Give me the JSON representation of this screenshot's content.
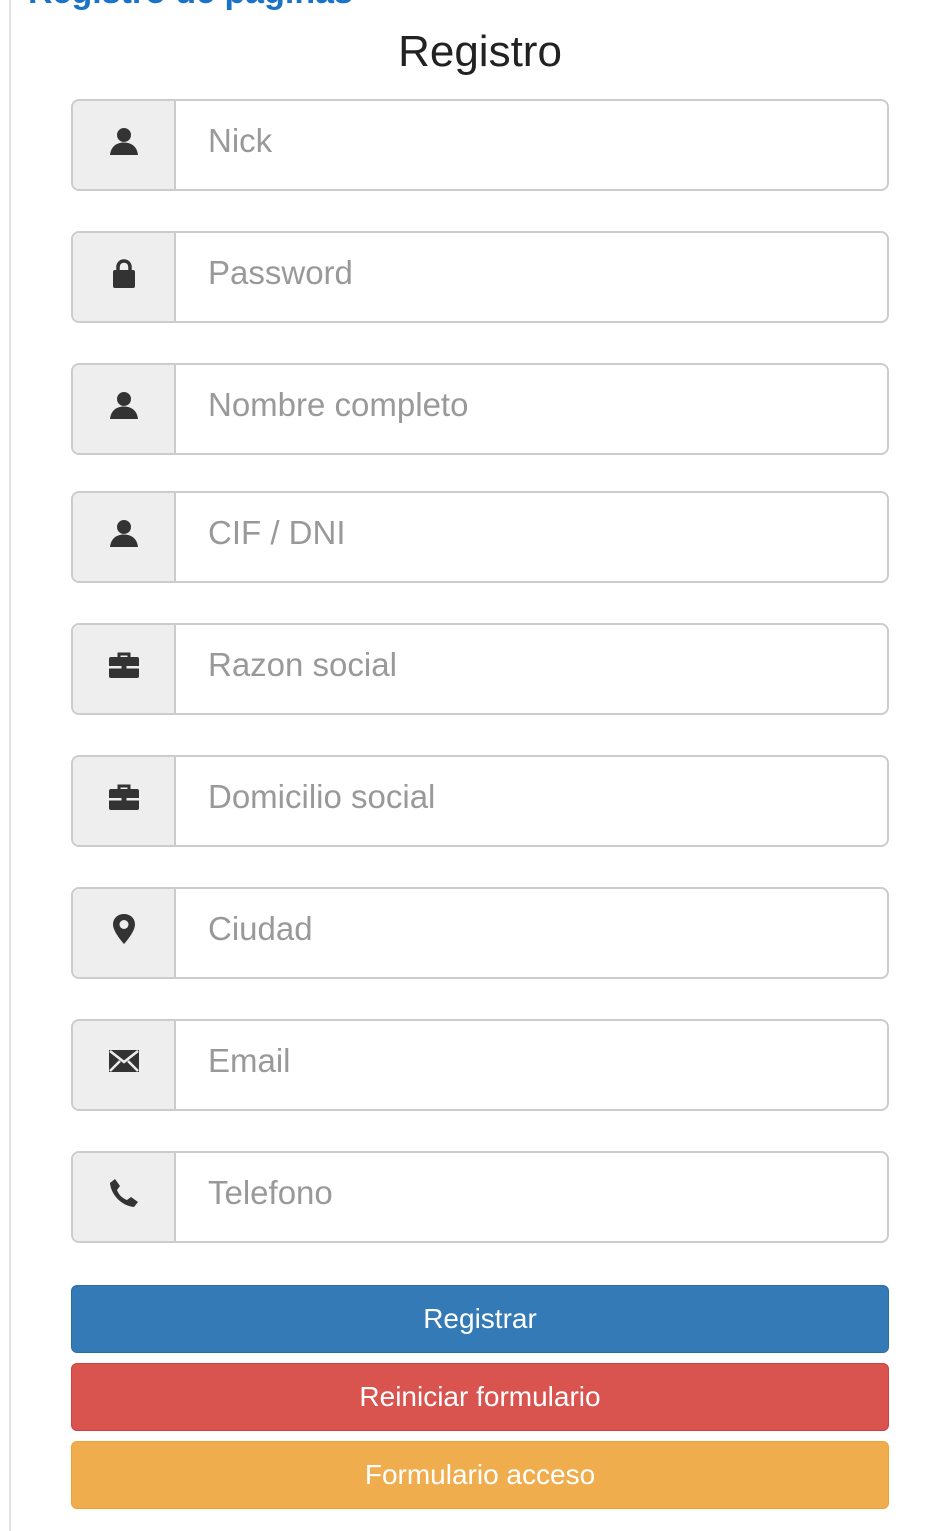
{
  "header": {
    "cut_heading": "Registro de páginas",
    "title": "Registro"
  },
  "form": {
    "fields": [
      {
        "icon": "user-icon",
        "placeholder": "Nick",
        "value": ""
      },
      {
        "icon": "lock-icon",
        "placeholder": "Password",
        "value": ""
      },
      {
        "icon": "user-icon",
        "placeholder": "Nombre completo",
        "value": ""
      },
      {
        "icon": "user-icon",
        "placeholder": "CIF / DNI",
        "value": ""
      },
      {
        "icon": "briefcase-icon",
        "placeholder": "Razon social",
        "value": ""
      },
      {
        "icon": "briefcase-icon",
        "placeholder": "Domicilio social",
        "value": ""
      },
      {
        "icon": "map-marker-icon",
        "placeholder": "Ciudad",
        "value": ""
      },
      {
        "icon": "envelope-icon",
        "placeholder": "Email",
        "value": ""
      },
      {
        "icon": "phone-icon",
        "placeholder": "Telefono",
        "value": ""
      }
    ]
  },
  "buttons": {
    "register": "Registrar",
    "reset": "Reiniciar formulario",
    "access": "Formulario acceso"
  },
  "colors": {
    "primary": "#337ab7",
    "danger": "#d9534f",
    "warning": "#f0ad4e",
    "addon_bg": "#eeeeee",
    "border": "#cccccc",
    "icon": "#333333",
    "link_heading": "#1a73c8"
  }
}
